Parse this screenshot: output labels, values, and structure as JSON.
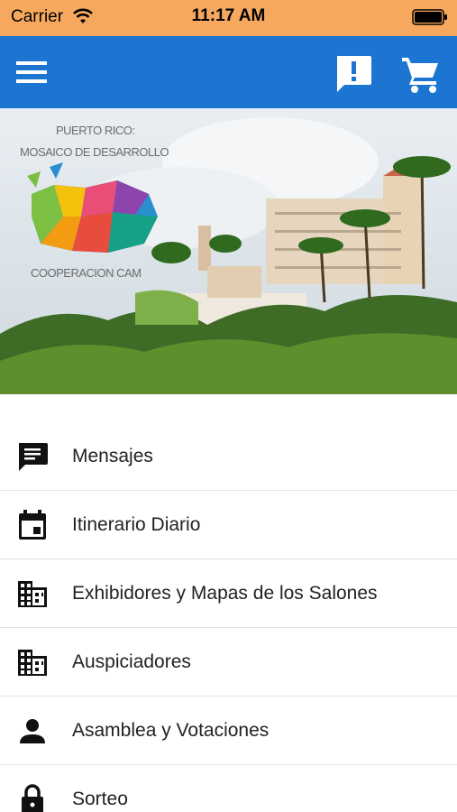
{
  "status_bar": {
    "carrier": "Carrier",
    "time": "11:17 AM",
    "wifi_icon": "wifi-icon",
    "battery_icon": "battery-icon"
  },
  "app_bar": {
    "color": "#1d75d2",
    "menu_icon": "menu-icon",
    "feedback_icon": "feedback-icon",
    "cart_icon": "shopping-cart-icon"
  },
  "banner": {
    "logo_line1": "PUERTO RICO:",
    "logo_line2": "MOSAICO DE DESARROLLO",
    "logo_line3": "COOPERACION CAM"
  },
  "menu": {
    "items": [
      {
        "label": "Mensajes",
        "icon": "message-icon"
      },
      {
        "label": "Itinerario Diario",
        "icon": "calendar-icon"
      },
      {
        "label": "Exhibidores y Mapas de los Salones",
        "icon": "building-icon"
      },
      {
        "label": "Auspiciadores",
        "icon": "building-icon"
      },
      {
        "label": "Asamblea y Votaciones",
        "icon": "person-icon"
      },
      {
        "label": "Sorteo",
        "icon": "lock-icon"
      }
    ]
  }
}
